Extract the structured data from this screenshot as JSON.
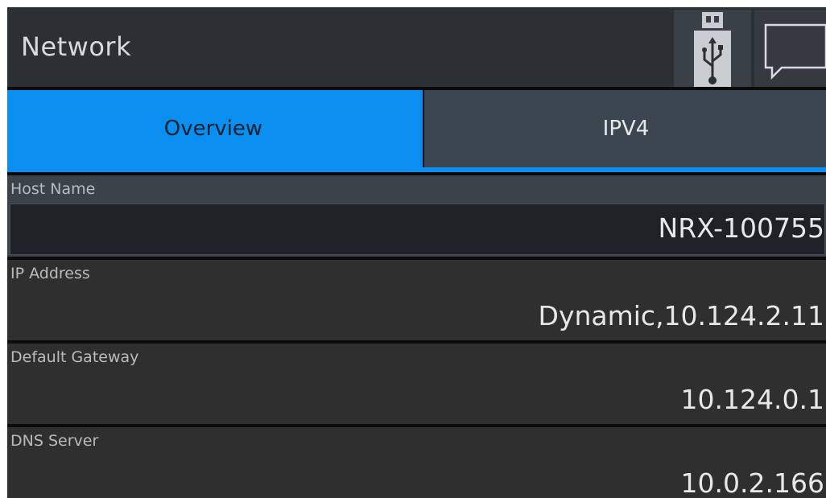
{
  "header": {
    "title": "Network",
    "usb_icon": "usb-drive-icon",
    "message_icon": "speech-bubble-icon"
  },
  "tabs": [
    {
      "label": "Overview",
      "active": true
    },
    {
      "label": "IPV4",
      "active": false
    }
  ],
  "fields": {
    "host_name": {
      "label": "Host Name",
      "value": "NRX-100755"
    },
    "ip_address": {
      "label": "IP Address",
      "value": "Dynamic,10.124.2.11"
    },
    "default_gateway": {
      "label": "Default Gateway",
      "value": "10.124.0.1"
    },
    "dns_server": {
      "label": "DNS Server",
      "value": "10.0.2.166"
    }
  },
  "colors": {
    "accent": "#0a8ef0",
    "header_bg": "#2c3035",
    "field_bg": "#2f2f2f",
    "inactive_tab_bg": "#3c4650"
  }
}
